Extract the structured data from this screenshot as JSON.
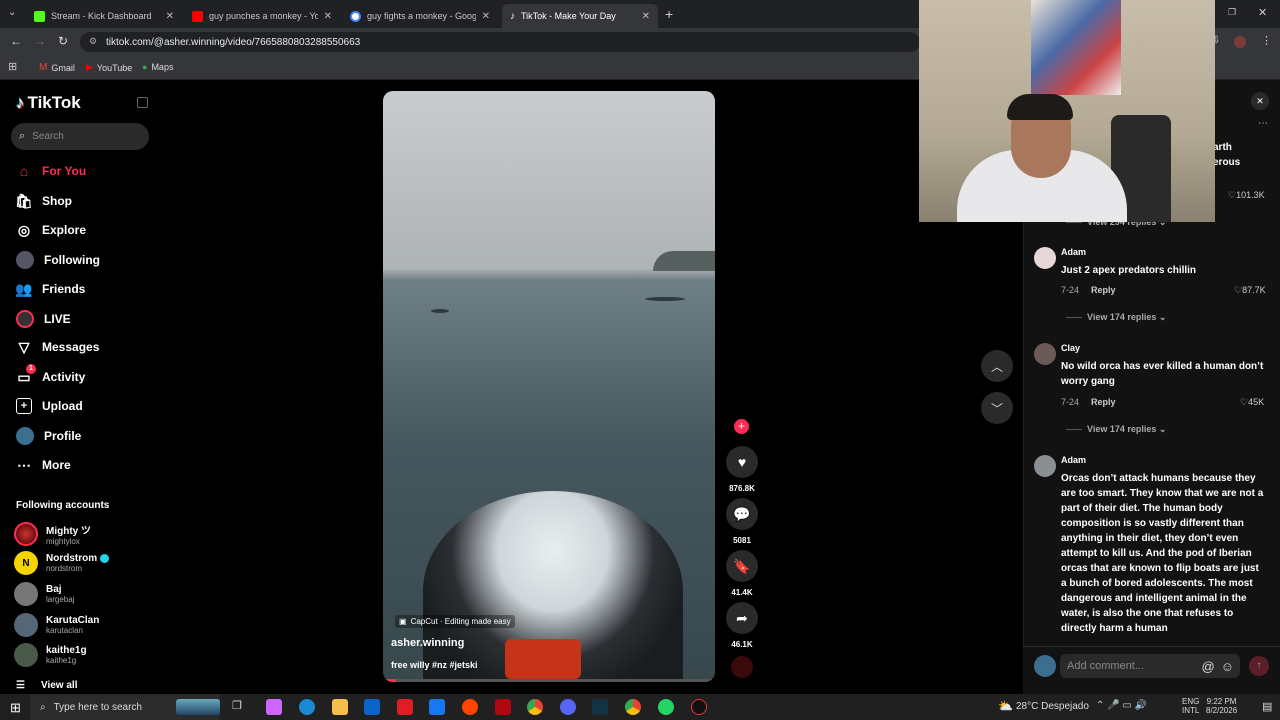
{
  "browser": {
    "tabs": [
      {
        "title": "Stream - Kick Dashboard",
        "color": "#53fc18"
      },
      {
        "title": "guy punches a monkey - YouTu",
        "color": "#ff0000"
      },
      {
        "title": "guy fights a monkey - Google S",
        "color": "#4285f4"
      },
      {
        "title": "TikTok - Make Your Day",
        "color": "#ffffff"
      }
    ],
    "url": "tiktok.com/@asher.winning/video/7665880803288550663",
    "bookmarks": [
      "Gmail",
      "YouTube",
      "Maps"
    ]
  },
  "tiktok": {
    "logo": "TikTok",
    "search_placeholder": "Search",
    "nav": [
      {
        "label": "For You",
        "icon": "home-icon",
        "active": true
      },
      {
        "label": "Shop",
        "icon": "shop-icon"
      },
      {
        "label": "Explore",
        "icon": "compass-icon"
      },
      {
        "label": "Following",
        "icon": "following-avatar-icon"
      },
      {
        "label": "Friends",
        "icon": "friends-icon"
      },
      {
        "label": "LIVE",
        "icon": "live-icon"
      },
      {
        "label": "Messages",
        "icon": "paper-plane-icon"
      },
      {
        "label": "Activity",
        "icon": "inbox-icon",
        "badge": "1"
      },
      {
        "label": "Upload",
        "icon": "plus-square-icon"
      },
      {
        "label": "Profile",
        "icon": "profile-avatar-icon"
      },
      {
        "label": "More",
        "icon": "more-dots-icon"
      }
    ],
    "following_title": "Following accounts",
    "accounts": [
      {
        "name": "Mighty ツ",
        "handle": "mightylox"
      },
      {
        "name": "Nordstrom",
        "handle": "nordstrom",
        "verified": true
      },
      {
        "name": "Baj",
        "handle": "largebaj"
      },
      {
        "name": "KarutaClan",
        "handle": "karutaclan"
      },
      {
        "name": "kaithe1g",
        "handle": "kaithe1g"
      }
    ],
    "view_all": "View all",
    "video": {
      "capcut": "CapCut · Editing made easy",
      "author": "asher.winning",
      "caption": "free willy #nz #jetski"
    },
    "actions": {
      "likes": "876.8K",
      "comments": "5081",
      "saves": "41.4K",
      "shares": "46.1K"
    },
    "comments": {
      "partial_text_1": "arth",
      "partial_text_2": "erous",
      "partial_likes": "101.3K",
      "partial_replies": "View 294 replies",
      "items": [
        {
          "user": "Adam",
          "text": "Just 2 apex predators chillin",
          "date": "7-24",
          "reply": "Reply",
          "likes": "87.7K",
          "replies": "View 174 replies"
        },
        {
          "user": "Clay",
          "text": "No wild orca has ever killed a human don’t worry gang",
          "date": "7-24",
          "reply": "Reply",
          "likes": "45K",
          "replies": "View 174 replies"
        },
        {
          "user": "Adam",
          "text": "Orcas don’t attack humans because they are too smart. They know that we are not a part of their diet. The human body composition is so vastly different than anything in their diet, they don’t even attempt to kill us. And the pod of Iberian orcas that are known to flip boats are just a bunch of bored adolescents. The most dangerous and intelligent animal in the water, is also the one that refuses to directly harm a human"
        }
      ],
      "add_placeholder": "Add comment..."
    }
  },
  "taskbar": {
    "search_placeholder": "Type here to search",
    "weather": "28°C  Despejado",
    "lang1": "ENG",
    "lang2": "INTL",
    "time": "9:22 PM",
    "date": "8/2/2026"
  }
}
